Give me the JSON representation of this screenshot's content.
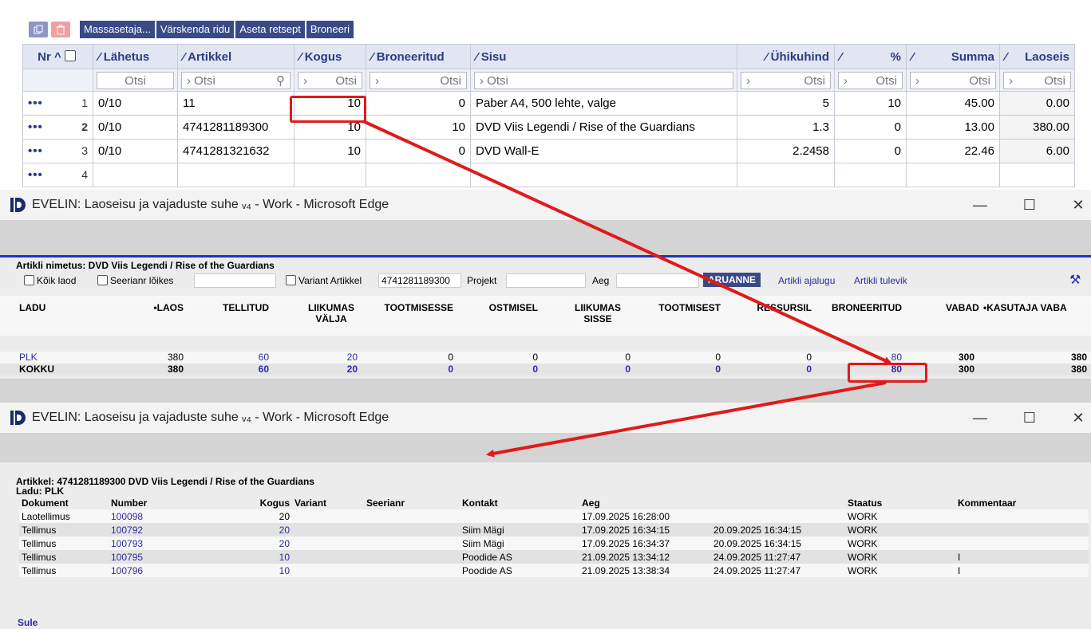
{
  "toolbar": {
    "copy_icon": "copy-icon",
    "delete_icon": "trash-icon",
    "buttons": [
      "Massasetaja...",
      "Värskenda ridu",
      "Aseta retsept",
      "Broneeri"
    ]
  },
  "grid": {
    "headers": {
      "nr": "Nr ^",
      "lahetus": "Lähetus",
      "artikkel": "Artikkel",
      "kogus": "Kogus",
      "broneeritud": "Broneeritud",
      "sisu": "Sisu",
      "uhikuhind": "Ühikuhind",
      "percent": "%",
      "summa": "Summa",
      "laoseis": "Laoseis"
    },
    "search_placeholder": "Otsi",
    "rows": [
      {
        "dots": "•••",
        "nr": "1",
        "lahetus": "0/10",
        "artikkel": "11",
        "kogus": "10",
        "broneeritud": "0",
        "sisu": "Paber A4, 500 lehte, valge",
        "uhikuhind": "5",
        "percent": "10",
        "summa": "45.00",
        "laoseis": "0.00"
      },
      {
        "dots": "•••",
        "nr": "2",
        "lahetus": "0/10",
        "artikkel": "4741281189300",
        "kogus": "10",
        "broneeritud": "10",
        "sisu": "DVD Viis Legendi / Rise of the Guardians",
        "uhikuhind": "1.3",
        "percent": "0",
        "summa": "13.00",
        "laoseis": "380.00"
      },
      {
        "dots": "•••",
        "nr": "3",
        "lahetus": "0/10",
        "artikkel": "4741281321632",
        "kogus": "10",
        "broneeritud": "0",
        "sisu": "DVD Wall-E",
        "uhikuhind": "2.2458",
        "percent": "0",
        "summa": "22.46",
        "laoseis": "6.00"
      },
      {
        "dots": "•••",
        "nr": "4"
      }
    ]
  },
  "window1": {
    "title": "EVELIN: Laoseisu ja vajaduste suhe ᵥ₄ - Work - Microsoft Edge",
    "article_name": "Artikli nimetus: DVD Viis Legendi / Rise of the Guardians",
    "filters": {
      "koik_laod": "Kõik laod",
      "seerianr": "Seerianr lõikes",
      "variant": "Variant Artikkel",
      "artikkel_value": "4741281189300",
      "projekt": "Projekt",
      "aeg": "Aeg",
      "aruanne": "ARUANNE",
      "ajalugu": "Artikli ajalugu",
      "tulevik": "Artikli tulevik"
    },
    "columns": {
      "ladu": "LADU",
      "laos": "•LAOS",
      "tellitud": "TELLITUD",
      "liikumas_valja_1": "LIIKUMAS",
      "liikumas_valja_2": "VÄLJA",
      "tootmisesse": "TOOTMISESSE",
      "ostmisel": "OSTMISEL",
      "liikumas_sisse_1": "LIIKUMAS",
      "liikumas_sisse_2": "SISSE",
      "tootmisest": "TOOTMISEST",
      "ressursil": "RESSURSIL",
      "broneeritud": "BRONEERITUD",
      "vabad": "VABAD",
      "kasutaja_vaba": "•KASUTAJA VABA"
    },
    "rows": [
      {
        "ladu": "PLK",
        "laos": "380",
        "tellitud": "60",
        "liikumas_valja": "20",
        "tootmisesse": "0",
        "ostmisel": "0",
        "liikumas_sisse": "0",
        "tootmisest": "0",
        "ressursil": "0",
        "broneeritud": "80",
        "vabad": "300",
        "kasutaja_vaba": "380"
      },
      {
        "ladu": "KOKKU",
        "laos": "380",
        "tellitud": "60",
        "liikumas_valja": "20",
        "tootmisesse": "0",
        "ostmisel": "0",
        "liikumas_sisse": "0",
        "tootmisest": "0",
        "ressursil": "0",
        "broneeritud": "80",
        "vabad": "300",
        "kasutaja_vaba": "380"
      }
    ]
  },
  "window2": {
    "title": "EVELIN: Laoseisu ja vajaduste suhe ᵥ₄ - Work - Microsoft Edge",
    "heading": "Artikkel: 4741281189300 DVD Viis Legendi / Rise of the Guardians",
    "ladu": "Ladu: PLK",
    "columns": {
      "dokument": "Dokument",
      "number": "Number",
      "kogus": "Kogus",
      "variant": "Variant",
      "seerianr": "Seerianr",
      "kontakt": "Kontakt",
      "aeg": "Aeg",
      "aeg2": "",
      "staatus": "Staatus",
      "kommentaar": "Kommentaar"
    },
    "rows": [
      {
        "dokument": "Laotellimus",
        "number": "100098",
        "kogus": "20",
        "kontakt": "",
        "aeg": "17.09.2025 16:28:00",
        "aeg2": "",
        "staatus": "WORK",
        "kommentaar": ""
      },
      {
        "dokument": "Tellimus",
        "number": "100792",
        "kogus": "20",
        "kontakt": "Siim Mägi",
        "aeg": "17.09.2025 16:34:15",
        "aeg2": "20.09.2025 16:34:15",
        "staatus": "WORK",
        "kommentaar": ""
      },
      {
        "dokument": "Tellimus",
        "number": "100793",
        "kogus": "20",
        "kontakt": "Siim Mägi",
        "aeg": "17.09.2025 16:34:37",
        "aeg2": "20.09.2025 16:34:15",
        "staatus": "WORK",
        "kommentaar": ""
      },
      {
        "dokument": "Tellimus",
        "number": "100795",
        "kogus": "10",
        "kontakt": "Poodide AS",
        "aeg": "21.09.2025 13:34:12",
        "aeg2": "24.09.2025 11:27:47",
        "staatus": "WORK",
        "kommentaar": "I"
      },
      {
        "dokument": "Tellimus",
        "number": "100796",
        "kogus": "10",
        "kontakt": "Poodide AS",
        "aeg": "21.09.2025 13:38:34",
        "aeg2": "24.09.2025 11:27:47",
        "staatus": "WORK",
        "kommentaar": "I"
      }
    ],
    "sule": "Sule"
  },
  "colors": {
    "accent": "#3a4a86",
    "highlight_red": "#e01a1a",
    "link_blue": "#2a2aa5",
    "header_blue": "#2c3b82"
  },
  "window_controls": [
    "minimize-icon",
    "maximize-icon",
    "close-icon"
  ]
}
